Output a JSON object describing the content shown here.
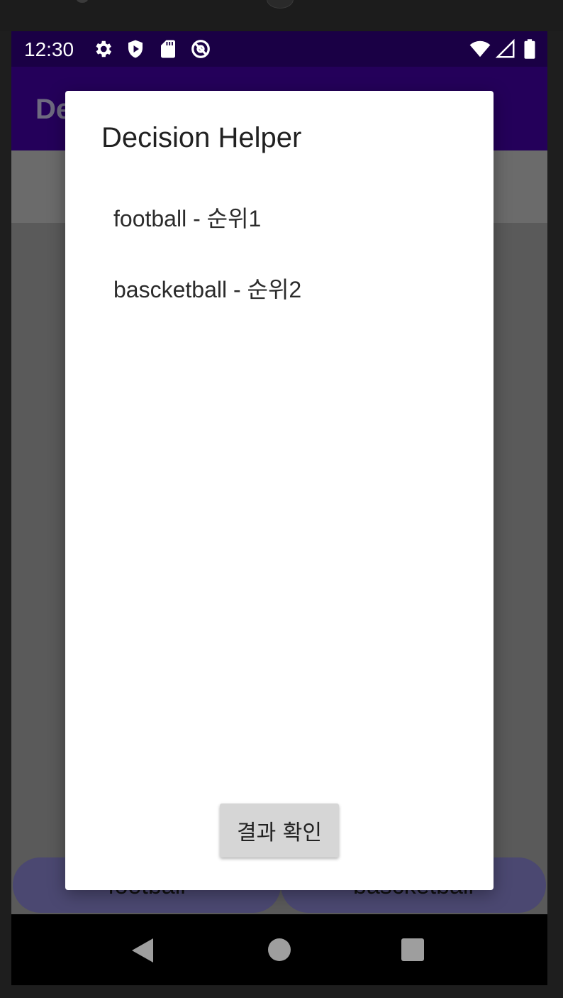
{
  "status_bar": {
    "time": "12:30",
    "icons": [
      "gear-icon",
      "shield-play-icon",
      "sd-card-icon",
      "at-circle-icon",
      "wifi-icon",
      "signal-icon",
      "battery-icon"
    ]
  },
  "app_bar": {
    "title_visible": "De"
  },
  "choices": {
    "left_label": "football",
    "right_label": "bascketball"
  },
  "dialog": {
    "title": "Decision Helper",
    "items": [
      {
        "label": "football - 순위1"
      },
      {
        "label": "bascketball - 순위2"
      }
    ],
    "confirm_label": "결과 확인"
  },
  "colors": {
    "status_bar": "#1a0045",
    "app_bar": "#24005a",
    "choice_button": "#4b4871",
    "scrim": "#5a5a5a"
  }
}
